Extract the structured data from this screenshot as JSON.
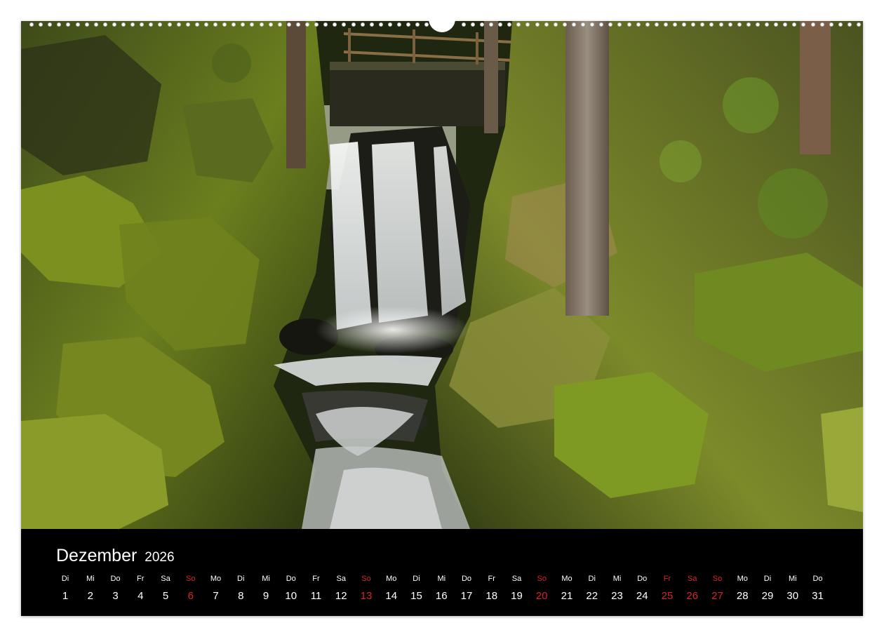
{
  "calendar": {
    "month": "Dezember",
    "year": "2026",
    "days": [
      {
        "wd": "Di",
        "d": "1",
        "red": false
      },
      {
        "wd": "Mi",
        "d": "2",
        "red": false
      },
      {
        "wd": "Do",
        "d": "3",
        "red": false
      },
      {
        "wd": "Fr",
        "d": "4",
        "red": false
      },
      {
        "wd": "Sa",
        "d": "5",
        "red": false
      },
      {
        "wd": "So",
        "d": "6",
        "red": true
      },
      {
        "wd": "Mo",
        "d": "7",
        "red": false
      },
      {
        "wd": "Di",
        "d": "8",
        "red": false
      },
      {
        "wd": "Mi",
        "d": "9",
        "red": false
      },
      {
        "wd": "Do",
        "d": "10",
        "red": false
      },
      {
        "wd": "Fr",
        "d": "11",
        "red": false
      },
      {
        "wd": "Sa",
        "d": "12",
        "red": false
      },
      {
        "wd": "So",
        "d": "13",
        "red": true
      },
      {
        "wd": "Mo",
        "d": "14",
        "red": false
      },
      {
        "wd": "Di",
        "d": "15",
        "red": false
      },
      {
        "wd": "Mi",
        "d": "16",
        "red": false
      },
      {
        "wd": "Do",
        "d": "17",
        "red": false
      },
      {
        "wd": "Fr",
        "d": "18",
        "red": false
      },
      {
        "wd": "Sa",
        "d": "19",
        "red": false
      },
      {
        "wd": "So",
        "d": "20",
        "red": true
      },
      {
        "wd": "Mo",
        "d": "21",
        "red": false
      },
      {
        "wd": "Di",
        "d": "22",
        "red": false
      },
      {
        "wd": "Mi",
        "d": "23",
        "red": false
      },
      {
        "wd": "Do",
        "d": "24",
        "red": false
      },
      {
        "wd": "Fr",
        "d": "25",
        "red": true
      },
      {
        "wd": "Sa",
        "d": "26",
        "red": true
      },
      {
        "wd": "So",
        "d": "27",
        "red": true
      },
      {
        "wd": "Mo",
        "d": "28",
        "red": false
      },
      {
        "wd": "Di",
        "d": "29",
        "red": false
      },
      {
        "wd": "Mi",
        "d": "30",
        "red": false
      },
      {
        "wd": "Do",
        "d": "31",
        "red": false
      }
    ]
  },
  "colors": {
    "background": "#000000",
    "holiday": "#d4252b",
    "text": "#ffffff"
  }
}
